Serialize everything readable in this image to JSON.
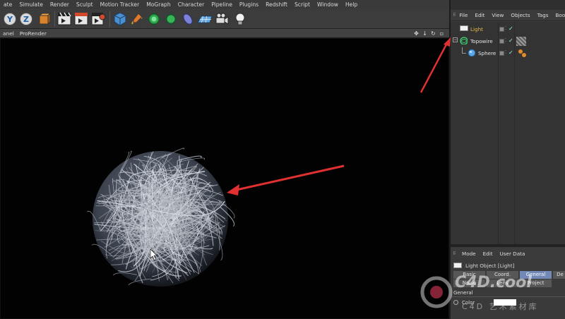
{
  "menubar": {
    "items": [
      "ate",
      "Simulate",
      "Render",
      "Sculpt",
      "Motion Tracker",
      "MoGraph",
      "Character",
      "Pipeline",
      "Plugins",
      "Redshift",
      "Script",
      "Window",
      "Help"
    ]
  },
  "toolbar": {
    "icons": [
      "y-axis-icon",
      "z-axis-icon",
      "coordinate-system-icon",
      "render-view-icon",
      "render-picture-viewer-icon",
      "render-settings-icon",
      "cube-icon",
      "pen-spline-icon",
      "subdivision-icon",
      "array-icon",
      "deformer-icon",
      "floor-icon",
      "camera-icon",
      "light-icon"
    ]
  },
  "viewport_header": {
    "items": [
      "anel",
      "ProRender"
    ]
  },
  "object_manager": {
    "menu": [
      "File",
      "Edit",
      "View",
      "Objects",
      "Tags",
      "Book"
    ],
    "objects": [
      {
        "name": "Light",
        "color": "#e8b84a",
        "icon": "light-object-icon"
      },
      {
        "name": "Topowire",
        "color": "#e6e6e6",
        "icon": "topowire-icon"
      },
      {
        "name": "Sphere",
        "color": "#e6e6e6",
        "icon": "sphere-icon"
      }
    ]
  },
  "attribute_manager": {
    "menu": [
      "Mode",
      "Edit",
      "User Data"
    ],
    "title": "Light Object [Light]",
    "tabs_row1": [
      "Basic",
      "Coord.",
      "General",
      "De"
    ],
    "tabs_row2": [
      "Noise",
      "Lens",
      "Project"
    ],
    "active_tab": "General",
    "section": "General",
    "color_label": "Color"
  },
  "watermark": {
    "main": "C4D.cool",
    "sub": "C4D 艺术素材库"
  },
  "colors": {
    "accent_tab": "#7289b8",
    "annotation_arrow": "#e03030",
    "light_label": "#e8b84a"
  }
}
